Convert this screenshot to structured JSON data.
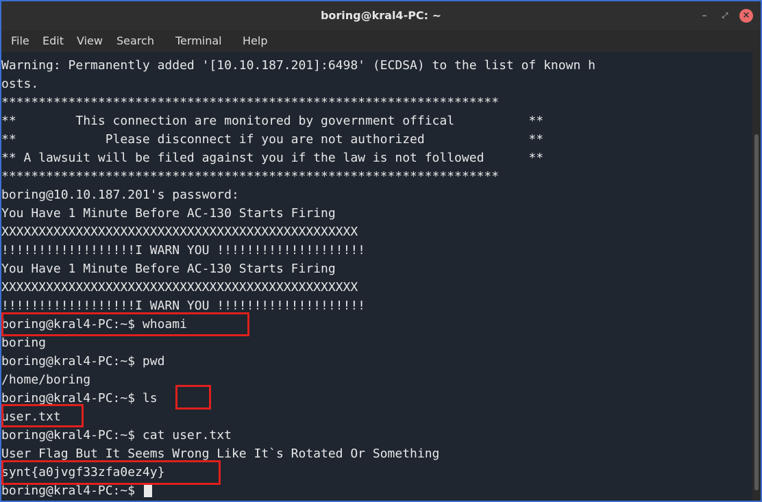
{
  "window": {
    "title": "boring@kral4-PC: ~"
  },
  "menu": {
    "file": "File",
    "edit": "Edit",
    "view": "View",
    "search": "Search",
    "terminal": "Terminal",
    "help": "Help"
  },
  "lines": [
    "Warning: Permanently added '[10.10.187.201]:6498' (ECDSA) to the list of known h",
    "osts.",
    "*******************************************************************",
    "**        This connection are monitored by government offical          **",
    "**            Please disconnect if you are not authorized              **",
    "** A lawsuit will be filed against you if the law is not followed      **",
    "*******************************************************************",
    "boring@10.10.187.201's password:",
    "You Have 1 Minute Before AC-130 Starts Firing",
    "XXXXXXXXXXXXXXXXXXXXXXXXXXXXXXXXXXXXXXXXXXXXXXXX",
    "!!!!!!!!!!!!!!!!!!I WARN YOU !!!!!!!!!!!!!!!!!!!!",
    "You Have 1 Minute Before AC-130 Starts Firing",
    "XXXXXXXXXXXXXXXXXXXXXXXXXXXXXXXXXXXXXXXXXXXXXXXX",
    "!!!!!!!!!!!!!!!!!!I WARN YOU !!!!!!!!!!!!!!!!!!!!",
    "boring@kral4-PC:~$ whoami",
    "boring",
    "boring@kral4-PC:~$ pwd",
    "/home/boring",
    "boring@kral4-PC:~$ ls",
    "user.txt",
    "boring@kral4-PC:~$ cat user.txt",
    "User Flag But It Seems Wrong Like It`s Rotated Or Something",
    "synt{a0jvgf33zfa0ez4y}",
    "boring@kral4-PC:~$ "
  ],
  "colors": {
    "terminal_bg": "#1f2630",
    "text": "#e8e8e8",
    "highlight": "#e0201c",
    "window_border": "#3b6fd4"
  }
}
